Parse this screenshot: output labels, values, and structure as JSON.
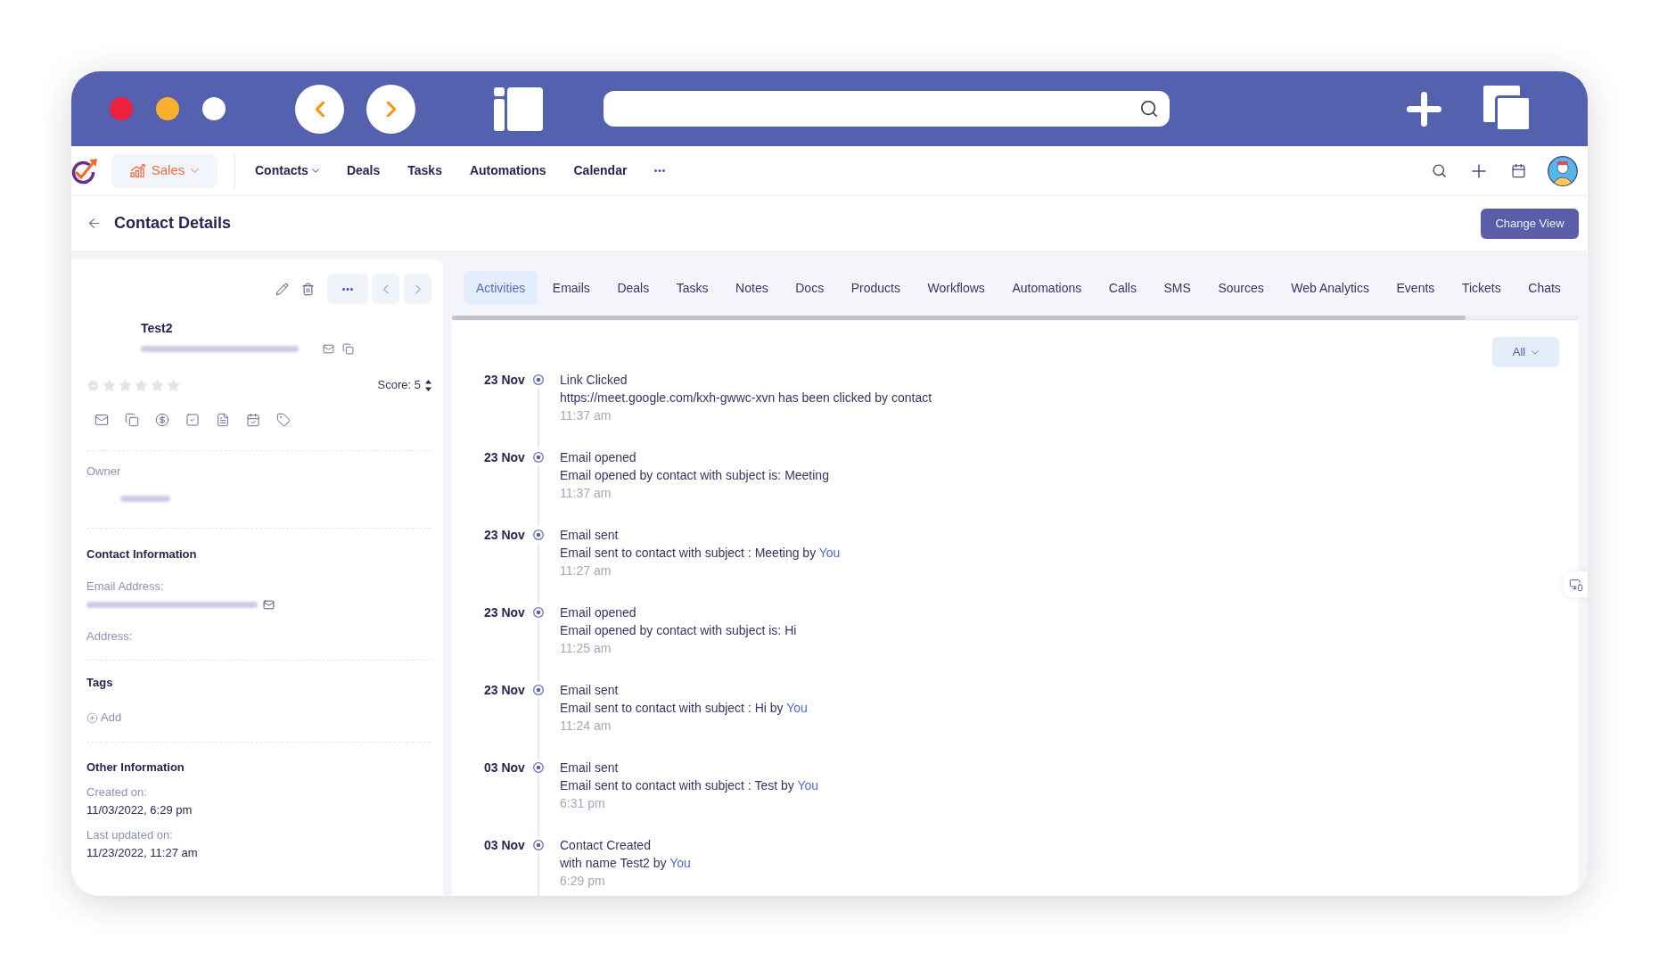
{
  "browser": {
    "window_controls": [
      {
        "color": "#ef1f3e"
      },
      {
        "color": "#fbb130"
      },
      {
        "color": "#ffffff"
      }
    ]
  },
  "app_nav": {
    "module": {
      "label": "Sales"
    },
    "items": [
      {
        "label": "Contacts",
        "has_menu": true
      },
      {
        "label": "Deals",
        "has_menu": false
      },
      {
        "label": "Tasks",
        "has_menu": false
      },
      {
        "label": "Automations",
        "has_menu": false
      },
      {
        "label": "Calendar",
        "has_menu": false
      }
    ]
  },
  "header": {
    "title": "Contact Details",
    "button": "Change View"
  },
  "contact": {
    "name": "Test2",
    "stars": 0,
    "score": "Score: 5",
    "owner_label": "Owner"
  },
  "contact_information": {
    "heading": "Contact Information",
    "fields": [
      {
        "label": "Email Address:",
        "kind": "email"
      },
      {
        "label": "Address:",
        "kind": "text"
      }
    ]
  },
  "tags": {
    "heading": "Tags",
    "add": "Add"
  },
  "other_information": {
    "heading": "Other Information",
    "fields": [
      {
        "label": "Created on:",
        "value": "11/03/2022, 6:29 pm"
      },
      {
        "label": "Last updated on:",
        "value": "11/23/2022, 11:27 am"
      }
    ]
  },
  "tabs": [
    {
      "label": "Activities",
      "selected": true
    },
    {
      "label": "Emails",
      "selected": false
    },
    {
      "label": "Deals",
      "selected": false
    },
    {
      "label": "Tasks",
      "selected": false
    },
    {
      "label": "Notes",
      "selected": false
    },
    {
      "label": "Docs",
      "selected": false
    },
    {
      "label": "Products",
      "selected": false
    },
    {
      "label": "Workflows",
      "selected": false
    },
    {
      "label": "Automations",
      "selected": false
    },
    {
      "label": "Calls",
      "selected": false
    },
    {
      "label": "SMS",
      "selected": false
    },
    {
      "label": "Sources",
      "selected": false
    },
    {
      "label": "Web Analytics",
      "selected": false
    },
    {
      "label": "Events",
      "selected": false
    },
    {
      "label": "Tickets",
      "selected": false
    },
    {
      "label": "Chats",
      "selected": false
    }
  ],
  "filter": {
    "label": "All"
  },
  "activities": [
    {
      "date": "23 Nov",
      "title": "Link Clicked",
      "description": "https://meet.google.com/kxh-gwwc-xvn has been clicked by contact",
      "time": "11:37 am"
    },
    {
      "date": "23 Nov",
      "title": "Email opened",
      "description": "Email opened by contact with subject is: Meeting",
      "time": "11:37 am"
    },
    {
      "date": "23 Nov",
      "title": "Email sent",
      "description": "Email sent to contact with subject : Meeting by",
      "actor": "You",
      "time": "11:27 am"
    },
    {
      "date": "23 Nov",
      "title": "Email opened",
      "description": "Email opened by contact with subject is: Hi",
      "time": "11:25 am"
    },
    {
      "date": "23 Nov",
      "title": "Email sent",
      "description": "Email sent to contact with subject : Hi by",
      "actor": "You",
      "time": "11:24 am"
    },
    {
      "date": "03 Nov",
      "title": "Email sent",
      "description": "Email sent to contact with subject : Test by",
      "actor": "You",
      "time": "6:31 pm"
    },
    {
      "date": "03 Nov",
      "title": "Contact Created",
      "description": "with name Test2 by",
      "actor": "You",
      "time": "6:29 pm"
    }
  ]
}
